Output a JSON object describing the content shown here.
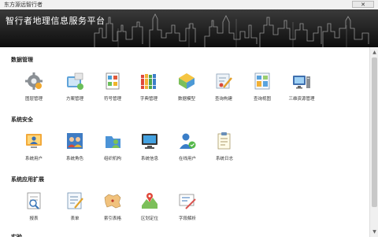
{
  "window": {
    "title": "东方源远智行者",
    "close_label": "✕"
  },
  "banner": {
    "brand": "智行者地理信息服务平台"
  },
  "sections": [
    {
      "title": "数据管理",
      "items": [
        {
          "label": "图层管理",
          "icon": "gear-icon"
        },
        {
          "label": "方案管理",
          "icon": "scheme-icon"
        },
        {
          "label": "符号管理",
          "icon": "symbol-icon"
        },
        {
          "label": "字典管理",
          "icon": "dictionary-icon"
        },
        {
          "label": "数据模型",
          "icon": "data-model-icon"
        },
        {
          "label": "查询构建",
          "icon": "query-build-icon"
        },
        {
          "label": "查询视图",
          "icon": "query-view-icon"
        },
        {
          "label": "三维资源管理",
          "icon": "3d-resource-icon"
        }
      ]
    },
    {
      "title": "系统安全",
      "items": [
        {
          "label": "系统用户",
          "icon": "system-user-icon"
        },
        {
          "label": "系统角色",
          "icon": "system-role-icon"
        },
        {
          "label": "组织机构",
          "icon": "organization-icon"
        },
        {
          "label": "系统信息",
          "icon": "system-info-icon"
        },
        {
          "label": "在线用户",
          "icon": "online-user-icon"
        },
        {
          "label": "系统日志",
          "icon": "system-log-icon"
        }
      ]
    },
    {
      "title": "系统应用扩展",
      "items": [
        {
          "label": "报表",
          "icon": "report-icon"
        },
        {
          "label": "表单",
          "icon": "form-icon"
        },
        {
          "label": "索引表格",
          "icon": "index-table-icon"
        },
        {
          "label": "区划定位",
          "icon": "region-locate-icon"
        },
        {
          "label": "字段解析",
          "icon": "field-parse-icon"
        }
      ]
    }
  ],
  "footer_partial": "实验"
}
